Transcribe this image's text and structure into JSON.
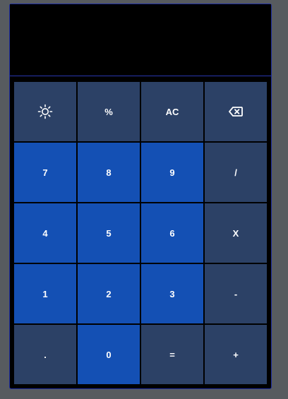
{
  "display": {
    "value": ""
  },
  "keys": {
    "theme_icon": "sun-icon",
    "percent": "%",
    "clear": "AC",
    "backspace_icon": "backspace-icon",
    "seven": "7",
    "eight": "8",
    "nine": "9",
    "divide": "/",
    "four": "4",
    "five": "5",
    "six": "6",
    "multiply": "X",
    "one": "1",
    "two": "2",
    "three": "3",
    "subtract": "-",
    "decimal": ".",
    "zero": "0",
    "equals": "=",
    "add": "+"
  },
  "colors": {
    "function_key": "#2c4166",
    "number_key": "#1450b4",
    "display_bg": "#000000",
    "page_bg": "#575b5f"
  }
}
